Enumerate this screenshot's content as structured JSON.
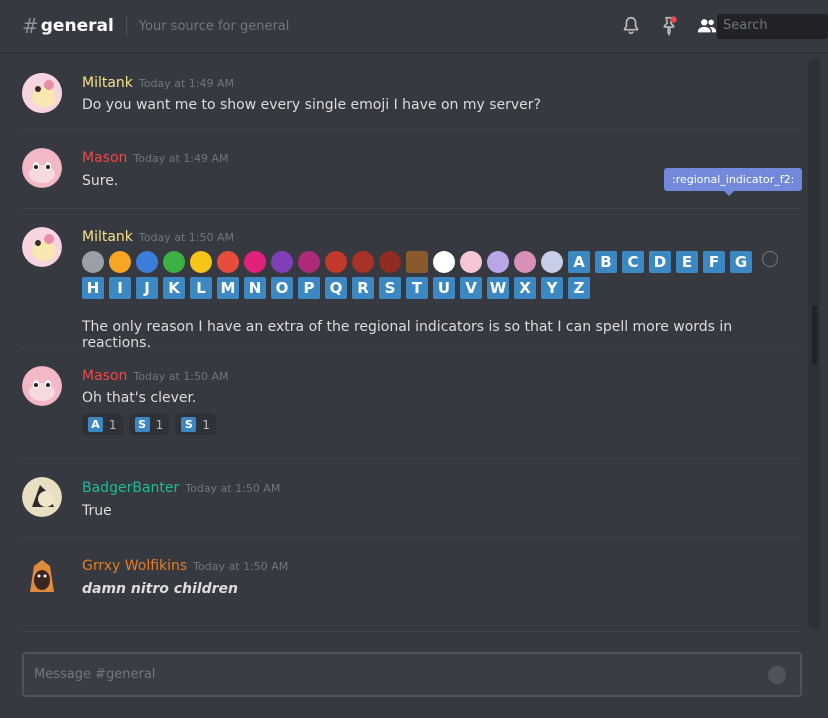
{
  "header": {
    "hash": "#",
    "channel": "general",
    "topic": "Your source for general"
  },
  "search": {
    "placeholder": "Search"
  },
  "messages": [
    {
      "user": "Miltank",
      "color": "#f7e08b",
      "time": "Today at 1:49 AM",
      "text": "Do you want me to show every single emoji I have on my server?"
    },
    {
      "user": "Mason",
      "color": "#f04747",
      "time": "Today at 1:49 AM",
      "text": "Sure."
    },
    {
      "user": "Miltank",
      "color": "#f7e08b",
      "time": "Today at 1:50 AM",
      "text": "The only reason I have an extra of the regional indicators is so that I can spell more words in reactions."
    },
    {
      "user": "Mason",
      "color": "#f04747",
      "time": "Today at 1:50 AM",
      "text": "Oh that's clever."
    },
    {
      "user": "BadgerBanter",
      "color": "#1abc9c",
      "time": "Today at 1:50 AM",
      "text": "True"
    },
    {
      "user": "Grrxy Wolfikins",
      "color": "#e67e22",
      "time": "Today at 1:50 AM",
      "text": "damn nitro children"
    }
  ],
  "regional_letters": [
    "A",
    "B",
    "C",
    "D",
    "E",
    "F",
    "G",
    "H",
    "I",
    "J",
    "K",
    "L",
    "M",
    "N",
    "O",
    "P",
    "Q",
    "R",
    "S",
    "T",
    "U",
    "V",
    "W",
    "X",
    "Y",
    "Z"
  ],
  "tooltip": ":regional_indicator_f2:",
  "reactions": [
    {
      "letter": "A",
      "count": "1"
    },
    {
      "letter": "S",
      "count": "1"
    },
    {
      "letter": "S",
      "count": "1"
    }
  ],
  "composer": {
    "placeholder": "Message #general"
  }
}
